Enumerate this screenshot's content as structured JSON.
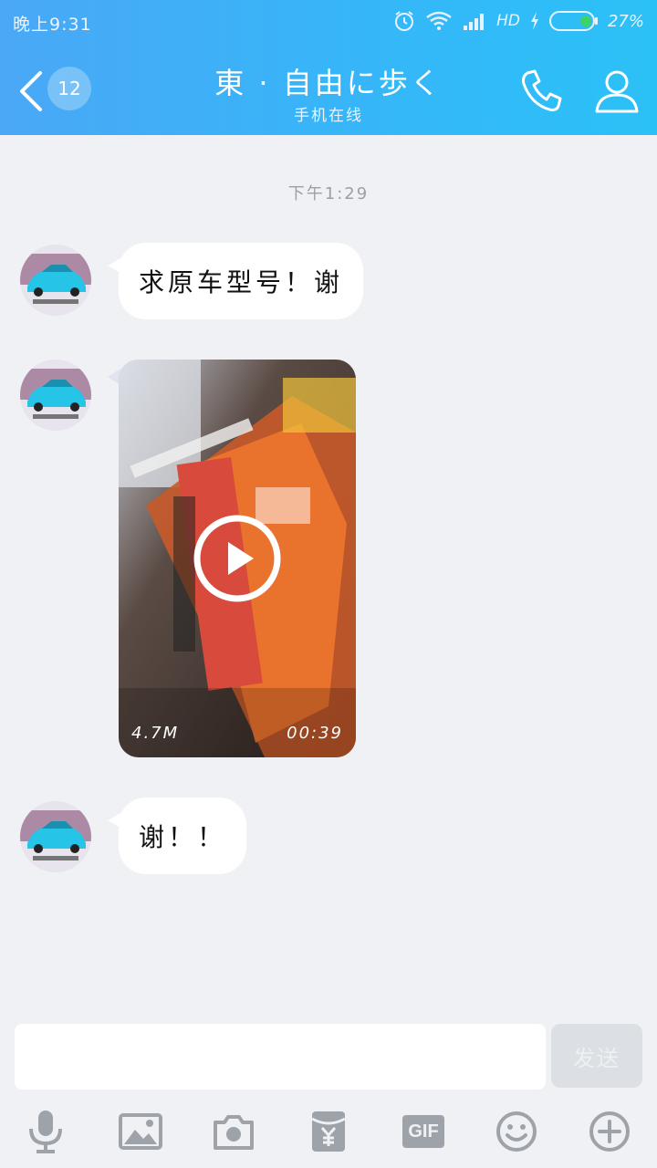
{
  "status_bar": {
    "time": "晚上9:31",
    "network": "HD",
    "battery_percent": "27%"
  },
  "header": {
    "unread_count": "12",
    "contact_name": "東 · 自由に歩く",
    "contact_status": "手机在线"
  },
  "chat": {
    "timestamp": "下午1:29",
    "messages": [
      {
        "type": "text",
        "text": "求原车型号！谢"
      },
      {
        "type": "video",
        "size": "4.7M",
        "duration": "00:39"
      },
      {
        "type": "text",
        "text": "谢！！"
      }
    ]
  },
  "composer": {
    "input_value": "",
    "send_label": "发送"
  },
  "toolbar": {
    "items": [
      "mic-icon",
      "image-icon",
      "camera-icon",
      "red-packet-icon",
      "gif-icon",
      "emoji-icon",
      "plus-icon"
    ],
    "gif_label": "GIF"
  },
  "colors": {
    "header_gradient_start": "#4aa8f6",
    "header_gradient_end": "#2bc1f7",
    "chat_background": "#f0f1f5",
    "bubble": "#ffffff",
    "toolbar_icon": "#9ea3aa"
  }
}
